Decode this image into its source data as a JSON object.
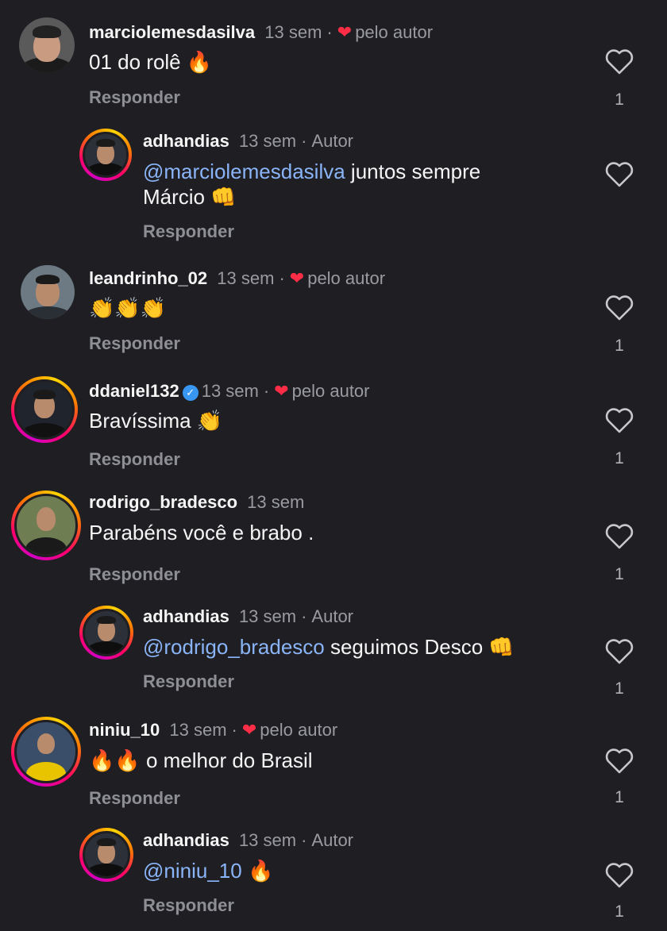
{
  "comments": [
    {
      "username": "marciolemesdasilva",
      "time": "13 sem",
      "liked_by_author": "pelo autor",
      "text": "01 do rolê 🔥",
      "reply_label": "Responder",
      "likes": "1"
    },
    {
      "username": "adhandias",
      "time": "13 sem",
      "author_label": "Autor",
      "mention": "@marciolemesdasilva",
      "text_line1": " juntos sempre",
      "text_line2": "Márcio 👊",
      "reply_label": "Responder",
      "likes": ""
    },
    {
      "username": "leandrinho_02",
      "time": "13 sem",
      "liked_by_author": "pelo autor",
      "text": "👏👏👏",
      "reply_label": "Responder",
      "likes": "1"
    },
    {
      "username": "ddaniel132",
      "verified": "✓",
      "time": "13 sem",
      "liked_by_author": "pelo autor",
      "text": "Bravíssima 👏",
      "reply_label": "Responder",
      "likes": "1"
    },
    {
      "username": "rodrigo_bradesco",
      "time": "13 sem",
      "text": "Parabéns você e brabo .",
      "reply_label": "Responder",
      "likes": "1"
    },
    {
      "username": "adhandias",
      "time": "13 sem",
      "author_label": "Autor",
      "mention": "@rodrigo_bradesco",
      "text": " seguimos Desco 👊",
      "reply_label": "Responder",
      "likes": "1"
    },
    {
      "username": "niniu_10",
      "time": "13 sem",
      "liked_by_author": "pelo autor",
      "text": "🔥🔥 o melhor do Brasil",
      "reply_label": "Responder",
      "likes": "1"
    },
    {
      "username": "adhandias",
      "time": "13 sem",
      "author_label": "Autor",
      "mention": "@niniu_10",
      "text": " 🔥",
      "reply_label": "Responder",
      "likes": "1"
    }
  ],
  "icons": {
    "like": "heart-outline-icon",
    "liked_by_author": "heart-filled-icon",
    "verified": "verified-badge-icon"
  },
  "colors": {
    "background": "#1f1f23",
    "mention": "#8ab4f8",
    "heart": "#ff2d45",
    "verified": "#3897f0"
  }
}
